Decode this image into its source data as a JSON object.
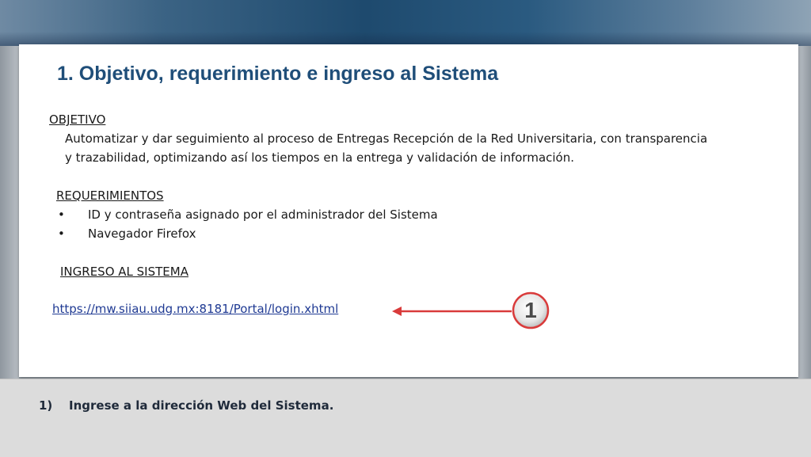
{
  "slide": {
    "title": "1. Objetivo, requerimiento e ingreso al Sistema",
    "objetivo": {
      "heading": "OBJETIVO",
      "line1": "Automatizar y dar seguimiento al proceso de Entregas Recepción de la Red Universitaria, con transparencia",
      "line2": "y trazabilidad, optimizando así los tiempos en la entrega y validación de información."
    },
    "requerimientos": {
      "heading": "REQUERIMIENTOS",
      "items": [
        "ID y contraseña asignado por el administrador del Sistema",
        "Navegador Firefox"
      ]
    },
    "ingreso": {
      "heading": "INGRESO AL SISTEMA",
      "url": "https://mw.siiau.udg.mx:8181/Portal/login.xhtml"
    },
    "callout": {
      "number": "1",
      "arrow_color": "#d93b3b"
    }
  },
  "footer": {
    "number": "1)",
    "text": "Ingrese a la dirección Web del Sistema."
  }
}
